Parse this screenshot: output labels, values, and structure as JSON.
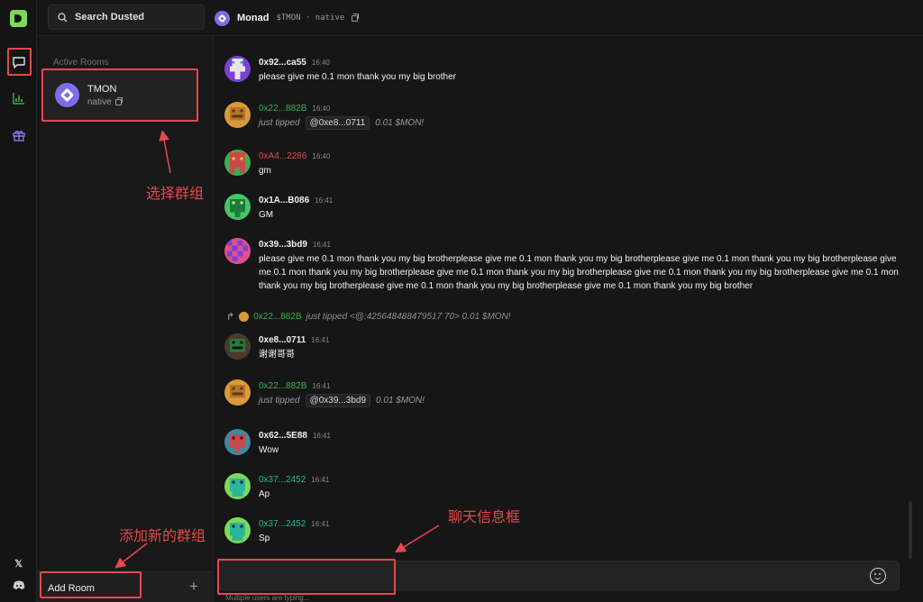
{
  "search": {
    "placeholder": "Search Dusted"
  },
  "topbar": {
    "name": "Monad",
    "ticker": "$TMON · native"
  },
  "rooms": {
    "title": "Active Rooms",
    "items": [
      {
        "name": "TMON",
        "sub": "native"
      }
    ],
    "add_label": "Add Room"
  },
  "messages": [
    {
      "addr": "0x92...ca55",
      "time": "16:40",
      "text": "please give me 0.1 mon thank you my big brother"
    },
    {
      "addr": "0x22...882B",
      "time": "16:40",
      "tip_prefix": "just tipped",
      "tip_to": "@0xe8...0711",
      "tip_amount": "0.01 $MON!"
    },
    {
      "addr": "0xA4...2286",
      "time": "16:40",
      "text": "gm"
    },
    {
      "addr": "0x1A...B086",
      "time": "16:41",
      "text": "GM"
    },
    {
      "addr": "0x39...3bd9",
      "time": "16:41",
      "text": "please give me 0.1 mon thank you my big brotherplease give me 0.1 mon thank you my big brotherplease give me 0.1 mon thank you my big brotherplease give me 0.1 mon thank you my big brotherplease give me 0.1 mon thank you my big brotherplease give me 0.1 mon thank you my big brotherplease give me 0.1 mon thank you my big brotherplease give me 0.1 mon thank you my big brotherplease give me 0.1 mon thank you my big brother"
    },
    {
      "addr": "0xe8...0711",
      "time": "16:41",
      "text": "谢谢哥哥"
    },
    {
      "addr": "0x22...882B",
      "time": "16:41",
      "tip_prefix": "just tipped",
      "tip_to": "@0x39...3bd9",
      "tip_amount": "0.01 $MON!"
    },
    {
      "addr": "0x62...5E88",
      "time": "16:41",
      "text": "Wow"
    },
    {
      "addr": "0x37...2452",
      "time": "16:41",
      "text": "Ap"
    },
    {
      "addr": "0x37...2452",
      "time": "16:41",
      "text": "Sp"
    }
  ],
  "reply": {
    "addr": "0x22...882B",
    "text": "just tipped <@:425648488479517 70> 0.01 $MON!"
  },
  "composer": {
    "value": "",
    "typing": "Multiple users are typing..."
  },
  "annotations": {
    "select_group": "选择群组",
    "add_group": "添加新的群组",
    "chat_box": "聊天信息框"
  },
  "colors": {
    "accent": "#7ed957",
    "annotation": "#e5484d",
    "tipper": "#3cb04b",
    "red_user": "#e24848",
    "teal_user": "#2bb59a",
    "monad": "#7c6ee6"
  },
  "icons": [
    "chat-icon",
    "chart-icon",
    "gift-icon",
    "x-icon",
    "discord-icon",
    "search-icon",
    "copy-icon",
    "plus-icon",
    "emoji-icon",
    "reply-arrow-icon"
  ]
}
